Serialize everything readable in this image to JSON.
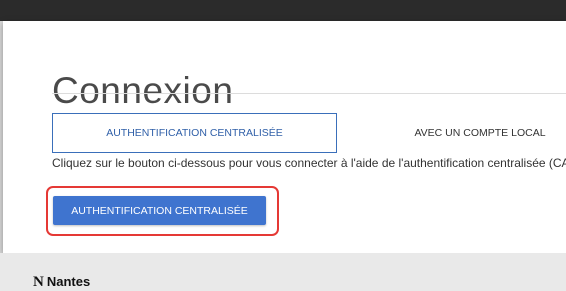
{
  "page": {
    "title": "Connexion"
  },
  "tabs": [
    {
      "label": "AUTHENTIFICATION CENTRALISÉE",
      "active": true
    },
    {
      "label": "AVEC UN COMPTE LOCAL",
      "active": false
    }
  ],
  "description": "Cliquez sur le bouton ci-dessous pour vous connecter à l'aide de l'authentification centralisée (CAS).",
  "cas_button": {
    "label": "AUTHENTIFICATION CENTRALISÉE"
  },
  "footer": {
    "logo_mark": "N",
    "logo_text": "Nantes"
  },
  "colors": {
    "accent": "#3f74cf",
    "highlight": "#e53935",
    "topbar": "#2b2b2b"
  }
}
